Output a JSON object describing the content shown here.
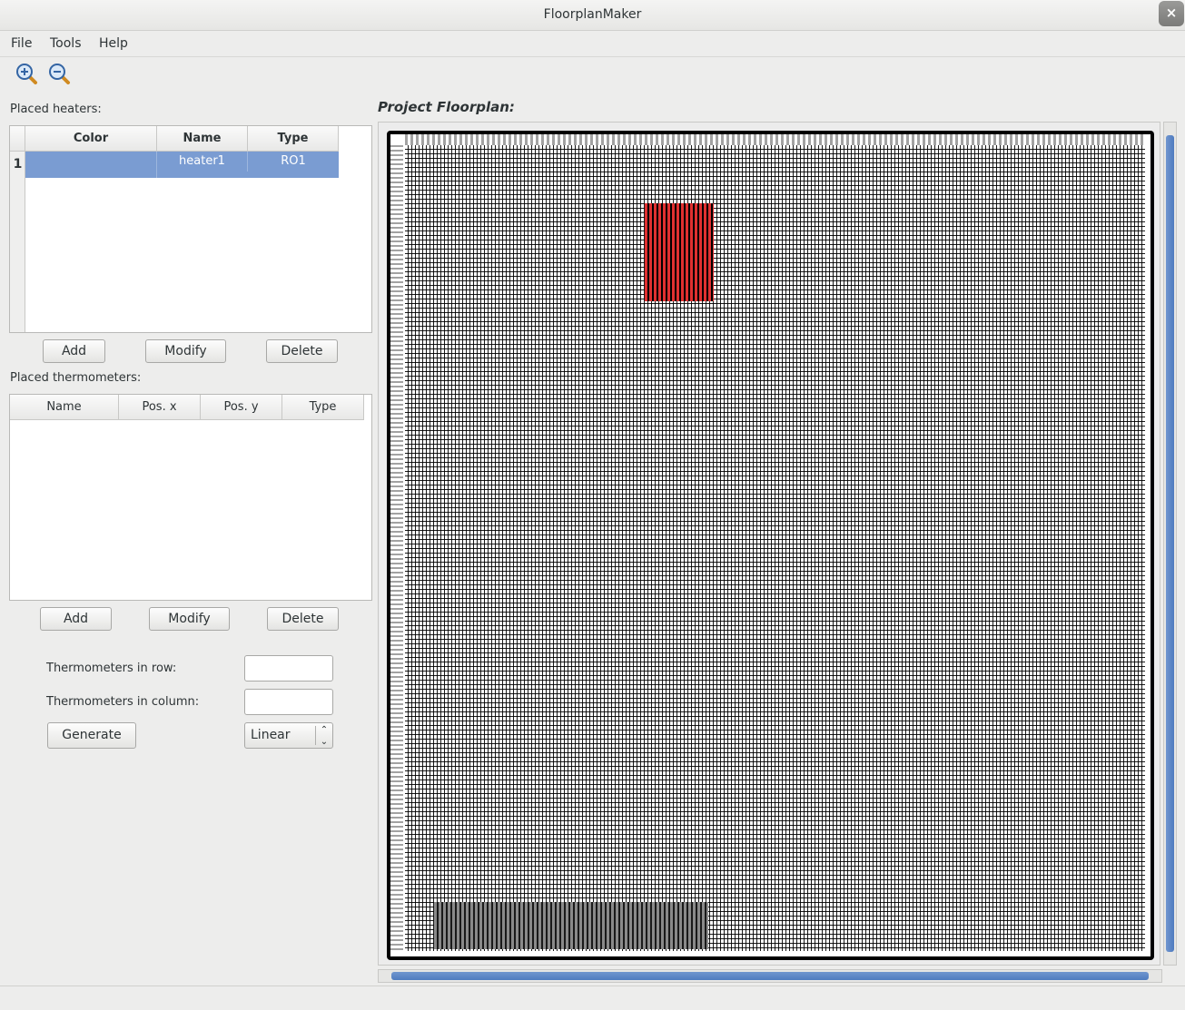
{
  "window": {
    "title": "FloorplanMaker",
    "close_glyph": "×"
  },
  "menu": {
    "file": "File",
    "tools": "Tools",
    "help": "Help"
  },
  "toolbar": {
    "zoom_in_icon": "zoom-in-icon",
    "zoom_out_icon": "zoom-out-icon"
  },
  "heaters": {
    "label": "Placed heaters:",
    "columns": [
      "Color",
      "Name",
      "Type"
    ],
    "rows": [
      {
        "index": "1",
        "name": "heater1",
        "type": "RO1"
      }
    ],
    "add": "Add",
    "modify": "Modify",
    "delete": "Delete"
  },
  "thermometers": {
    "label": "Placed thermometers:",
    "columns": [
      "Name",
      "Pos. x",
      "Pos. y",
      "Type"
    ],
    "add": "Add",
    "modify": "Modify",
    "delete": "Delete"
  },
  "generator": {
    "row_label": "Thermometers in row:",
    "col_label": "Thermometers in column:",
    "row_value": "",
    "col_value": "",
    "generate": "Generate",
    "mode": "Linear"
  },
  "floorplan": {
    "label": "Project Floorplan:",
    "colors": {
      "frame": "#000000",
      "cell": "#ffffff",
      "heater": "#e03030",
      "selection": "#7a9cd2",
      "disabled": "#8a8a8a"
    }
  }
}
